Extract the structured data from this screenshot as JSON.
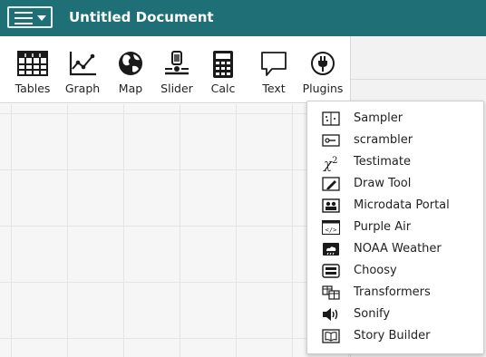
{
  "header": {
    "title": "Untitled Document"
  },
  "toolbar": {
    "tables": "Tables",
    "graph": "Graph",
    "map": "Map",
    "slider": "Slider",
    "calc": "Calc",
    "text": "Text",
    "plugins": "Plugins"
  },
  "plugins_menu": {
    "items": [
      {
        "label": "Sampler",
        "icon": "sampler-icon"
      },
      {
        "label": "scrambler",
        "icon": "scrambler-icon"
      },
      {
        "label": "Testimate",
        "icon": "chi-squared-icon"
      },
      {
        "label": "Draw Tool",
        "icon": "draw-tool-icon"
      },
      {
        "label": "Microdata Portal",
        "icon": "microdata-portal-icon"
      },
      {
        "label": "Purple Air",
        "icon": "code-icon"
      },
      {
        "label": "NOAA Weather",
        "icon": "weather-icon"
      },
      {
        "label": "Choosy",
        "icon": "choosy-icon"
      },
      {
        "label": "Transformers",
        "icon": "transformers-icon"
      },
      {
        "label": "Sonify",
        "icon": "speaker-icon"
      },
      {
        "label": "Story Builder",
        "icon": "story-builder-icon"
      }
    ],
    "chi_symbol": "χ",
    "chi_exponent": "2"
  },
  "colors": {
    "titlebar": "#1f6f77",
    "icon": "#1a1a1a"
  }
}
